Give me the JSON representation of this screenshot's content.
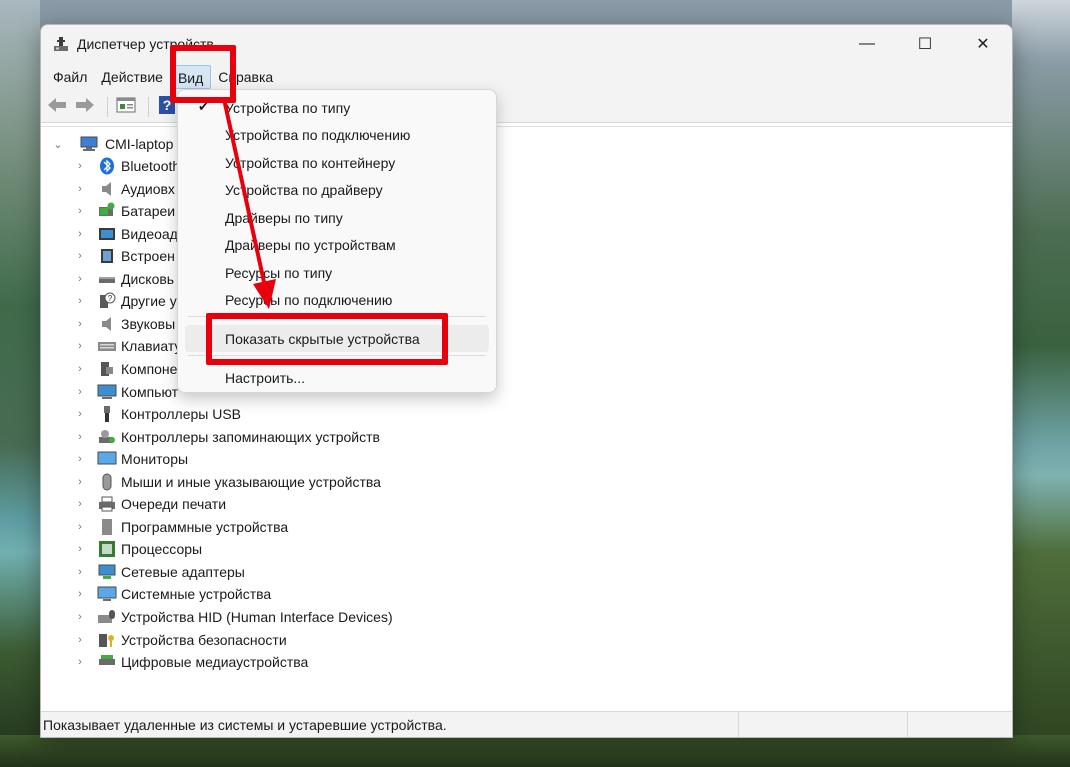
{
  "window": {
    "title": "Диспетчер устройств",
    "controls": {
      "minimize": "—",
      "maximize": "☐",
      "close": "✕"
    }
  },
  "menubar": {
    "items": [
      {
        "label": "Файл"
      },
      {
        "label": "Действие"
      },
      {
        "label": "Вид",
        "active": true
      },
      {
        "label": "Справка"
      }
    ]
  },
  "toolbar": {
    "buttons": [
      "back-icon",
      "forward-icon",
      "properties-icon",
      "help-icon"
    ]
  },
  "tree": {
    "root": "CMI-laptop",
    "items": [
      {
        "label": "Bluetooth",
        "icon": "bluetooth-icon"
      },
      {
        "label": "Аудиовх",
        "icon": "audio-io-icon"
      },
      {
        "label": "Батареи",
        "icon": "battery-icon"
      },
      {
        "label": "Видеоад",
        "icon": "display-adapter-icon"
      },
      {
        "label": "Встроен",
        "icon": "firmware-icon"
      },
      {
        "label": "Дисковь",
        "icon": "disk-drive-icon"
      },
      {
        "label": "Другие у",
        "icon": "other-devices-icon"
      },
      {
        "label": "Звуковы",
        "icon": "sound-icon"
      },
      {
        "label": "Клавиату",
        "icon": "keyboard-icon"
      },
      {
        "label": "Компоне",
        "icon": "software-component-icon"
      },
      {
        "label": "Компьют",
        "icon": "computer-icon"
      },
      {
        "label": "Контроллеры USB",
        "icon": "usb-icon"
      },
      {
        "label": "Контроллеры запоминающих устройств",
        "icon": "storage-controller-icon"
      },
      {
        "label": "Мониторы",
        "icon": "monitor-icon"
      },
      {
        "label": "Мыши и иные указывающие устройства",
        "icon": "mouse-icon"
      },
      {
        "label": "Очереди печати",
        "icon": "print-queue-icon"
      },
      {
        "label": "Программные устройства",
        "icon": "software-device-icon"
      },
      {
        "label": "Процессоры",
        "icon": "processor-icon"
      },
      {
        "label": "Сетевые адаптеры",
        "icon": "network-adapter-icon"
      },
      {
        "label": "Системные устройства",
        "icon": "system-devices-icon"
      },
      {
        "label": "Устройства HID (Human Interface Devices)",
        "icon": "hid-icon"
      },
      {
        "label": "Устройства безопасности",
        "icon": "security-device-icon"
      },
      {
        "label": "Цифровые медиаустройства",
        "icon": "media-device-icon"
      }
    ]
  },
  "view_menu": {
    "items": [
      {
        "label": "Устройства по типу",
        "checked": true
      },
      {
        "label": "Устройства по подключению"
      },
      {
        "label": "Устройства по контейнеру"
      },
      {
        "label": "Устройства по драйверу"
      },
      {
        "label": "Драйверы по типу"
      },
      {
        "label": "Драйверы по устройствам"
      },
      {
        "label": "Ресурсы по типу"
      },
      {
        "label": "Ресурсы по подключению"
      }
    ],
    "show_hidden": "Показать скрытые устройства",
    "customize": "Настроить...",
    "check_glyph": "✔"
  },
  "statusbar": {
    "text": "Показывает удаленные из системы и устаревшие устройства."
  },
  "annotation": {
    "color": "#e8000d"
  }
}
